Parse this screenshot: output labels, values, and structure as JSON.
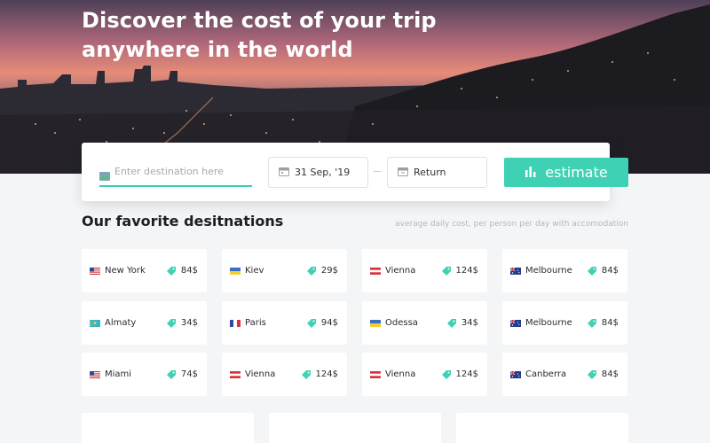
{
  "hero": {
    "title": "Discover the cost of your trip anywhere in the world"
  },
  "search": {
    "destination_placeholder": "Enter destination here",
    "depart_date": "31 Sep, '19",
    "return_label": "Return",
    "estimate_label": "estimate"
  },
  "section": {
    "title": "Our favorite desitnations",
    "note": "average daily cost, per person per day with accomodation"
  },
  "colors": {
    "accent": "#3fd1b3",
    "tag": "#3fd1b3"
  },
  "destinations": [
    {
      "city": "New York",
      "price": "84$",
      "flag": "us-flag-icon"
    },
    {
      "city": "Kiev",
      "price": "29$",
      "flag": "ua-flag-icon"
    },
    {
      "city": "Vienna",
      "price": "124$",
      "flag": "at-flag-icon"
    },
    {
      "city": "Melbourne",
      "price": "84$",
      "flag": "au-flag-icon"
    },
    {
      "city": "Almaty",
      "price": "34$",
      "flag": "kz-flag-icon"
    },
    {
      "city": "Paris",
      "price": "94$",
      "flag": "fr-flag-icon"
    },
    {
      "city": "Odessa",
      "price": "34$",
      "flag": "ua-flag-icon"
    },
    {
      "city": "Melbourne",
      "price": "84$",
      "flag": "au-flag-icon"
    },
    {
      "city": "Miami",
      "price": "74$",
      "flag": "us-flag-icon"
    },
    {
      "city": "Vienna",
      "price": "124$",
      "flag": "at-flag-icon"
    },
    {
      "city": "Vienna",
      "price": "124$",
      "flag": "at-flag-icon"
    },
    {
      "city": "Canberra",
      "price": "84$",
      "flag": "au-flag-icon"
    }
  ]
}
